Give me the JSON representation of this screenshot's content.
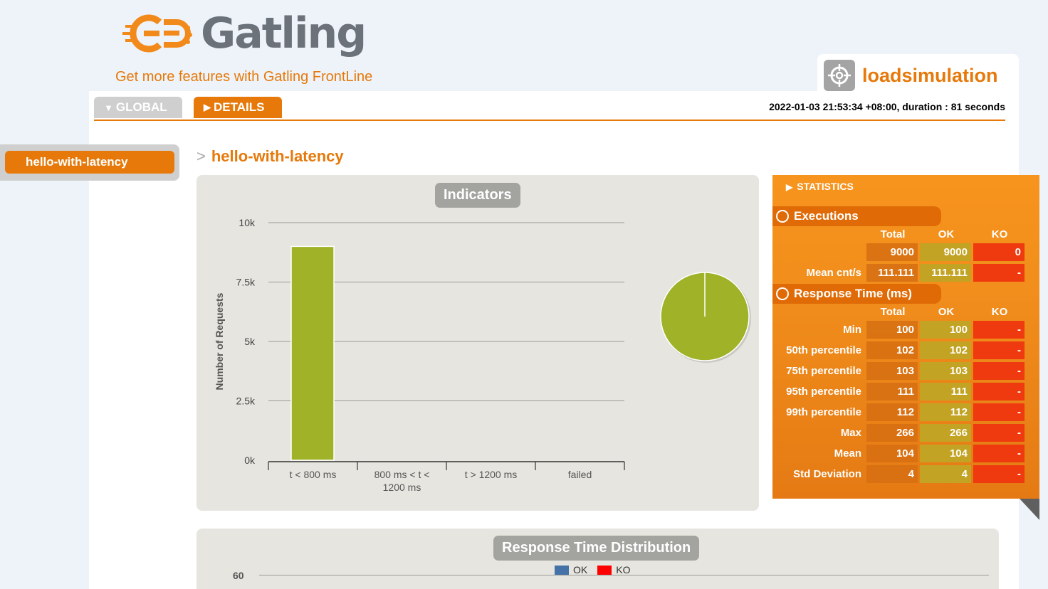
{
  "header": {
    "logo_text": "Gatling",
    "frontline_link": "Get more features with Gatling FrontLine",
    "simulation_name": "loadsimulation"
  },
  "tabs": [
    {
      "label": "GLOBAL",
      "active": false
    },
    {
      "label": "DETAILS",
      "active": true
    }
  ],
  "run_info": "2022-01-03 21:53:34 +08:00, duration : 81 seconds",
  "side_menu": {
    "items": [
      {
        "label": "hello-with-latency"
      }
    ]
  },
  "request_title": "hello-with-latency",
  "indicators": {
    "title": "Indicators",
    "chart_data": {
      "type": "bar",
      "ylabel": "Number of Requests",
      "categories": [
        "t < 800 ms",
        "800 ms < t < 1200 ms",
        "t > 1200 ms",
        "failed"
      ],
      "values": [
        9000,
        0,
        0,
        0
      ],
      "ylim": [
        0,
        10000
      ],
      "yticks": [
        "0k",
        "2.5k",
        "5k",
        "7.5k",
        "10k"
      ],
      "bar_color": "#a0b228",
      "pie": {
        "values": [
          9000,
          0,
          0,
          0
        ],
        "color": "#a0b228"
      }
    }
  },
  "statistics": {
    "title": "STATISTICS",
    "executions": {
      "title": "Executions",
      "columns": [
        "Total",
        "OK",
        "KO"
      ],
      "rows": [
        {
          "label": "",
          "total": "9000",
          "ok": "9000",
          "ko": "0"
        },
        {
          "label": "Mean cnt/s",
          "total": "111.111",
          "ok": "111.111",
          "ko": "-"
        }
      ]
    },
    "response_time": {
      "title": "Response Time (ms)",
      "columns": [
        "Total",
        "OK",
        "KO"
      ],
      "rows": [
        {
          "label": "Min",
          "total": "100",
          "ok": "100",
          "ko": "-"
        },
        {
          "label": "50th percentile",
          "total": "102",
          "ok": "102",
          "ko": "-"
        },
        {
          "label": "75th percentile",
          "total": "103",
          "ok": "103",
          "ko": "-"
        },
        {
          "label": "95th percentile",
          "total": "111",
          "ok": "111",
          "ko": "-"
        },
        {
          "label": "99th percentile",
          "total": "112",
          "ok": "112",
          "ko": "-"
        },
        {
          "label": "Max",
          "total": "266",
          "ok": "266",
          "ko": "-"
        },
        {
          "label": "Mean",
          "total": "104",
          "ok": "104",
          "ko": "-"
        },
        {
          "label": "Std Deviation",
          "total": "4",
          "ok": "4",
          "ko": "-"
        }
      ]
    }
  },
  "distribution": {
    "title": "Response Time Distribution",
    "legend": [
      {
        "name": "OK",
        "color": "#4572a7"
      },
      {
        "name": "KO",
        "color": "#ff0000"
      }
    ],
    "first_ytick": "60"
  },
  "colors": {
    "accent": "#e6790a",
    "ok": "#a0b228",
    "ko": "#ee3a0e"
  }
}
